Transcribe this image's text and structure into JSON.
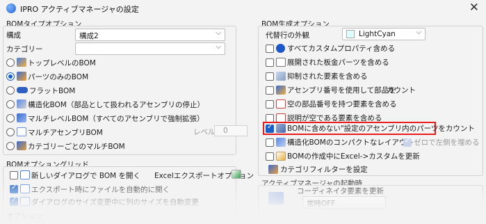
{
  "window": {
    "title": "IPRO アクティブマネージャの設定",
    "close_glyph": "✕"
  },
  "left": {
    "bom_type_section": "BOMタイプオプション",
    "config_label": "構成",
    "config_value": "構成2",
    "category_label": "カテゴリー",
    "category_value": "",
    "radios": [
      {
        "label": "トップレベルのBOM",
        "selected": false,
        "icon": "top-level-bom-icon"
      },
      {
        "label": "パーツのみのBOM",
        "selected": true,
        "icon": "parts-only-bom-icon"
      },
      {
        "label": "フラットBOM",
        "selected": false,
        "icon": "flat-bom-icon"
      },
      {
        "label": "構造化BOM（部品として扱われるアセンブリの停止）",
        "selected": false,
        "icon": "structured-bom-icon"
      },
      {
        "label": "マルチレベルBOM（すべてのアセンブリで強制拡張）",
        "selected": false,
        "icon": "multilevel-bom-icon"
      },
      {
        "label": "マルチアセンブリBOM",
        "selected": false,
        "icon": "multi-assembly-bom-icon"
      },
      {
        "label": "カテゴリーごとのマルチBOM",
        "selected": false,
        "icon": "category-multi-bom-icon"
      }
    ],
    "level_label": "レベル",
    "level_value": "0",
    "grid_section": "BOMオプショングリッド",
    "grid_items": [
      {
        "label": "新しいダイアログで BOM を開く",
        "checked": false
      },
      {
        "label": "エクスポート時にファイルを自動的に開く",
        "checked": true
      },
      {
        "label": "ダイアログのサイズ変更中に列のサイズを自動変更",
        "checked": true
      }
    ],
    "excel_export_label": "Excelエクスポートオプション",
    "options_section_partial": "オプション"
  },
  "right": {
    "bom_gen_section": "BOM生成オプション",
    "alt_row_label": "代替行の外観",
    "alt_row_value": "LightCyan",
    "alt_row_color": "#E0FFFF",
    "checks": [
      {
        "label": "すべてカスタムプロパティ含める",
        "checked": false,
        "icon": "custom-property-icon"
      },
      {
        "label": "展開された板金パーツを含める",
        "checked": false,
        "icon": "sheet-metal-icon"
      },
      {
        "label": "抑制された要素を含める",
        "checked": false,
        "icon": "suppressed-element-icon"
      },
      {
        "label": "アセンブリ番号を使用して部品を",
        "checked": false,
        "icon": "assembly-number-icon",
        "trailing": "カウント"
      },
      {
        "label": "空の部品番号を持つ要素を含める",
        "checked": false,
        "icon": "empty-part-number-icon"
      },
      {
        "label": "説明が空である要素を含める",
        "checked": false,
        "icon": "empty-description-icon"
      },
      {
        "label": "BOMに含めない\"設定のアセンブリ内のパーツをカウント",
        "checked": true,
        "icon": "exclude-from-bom-icon",
        "highlight": true
      },
      {
        "label": "構造化BOMのコンパクトなレイアウト",
        "checked": false,
        "icon": "compact-layout-icon"
      },
      {
        "label": "BOMの作成中にExcel->カスタムを更新",
        "checked": false,
        "icon": "excel-update-icon"
      }
    ],
    "left_align_zero_label": "ゼロで左側を埋める",
    "category_filter_label": "カテゴリフィルターを設定",
    "startup_section": "アクティブマネージャの起動時",
    "coordinator_label": "コーディネイタ要素を更新",
    "coordinator_value": "常時OFF"
  }
}
